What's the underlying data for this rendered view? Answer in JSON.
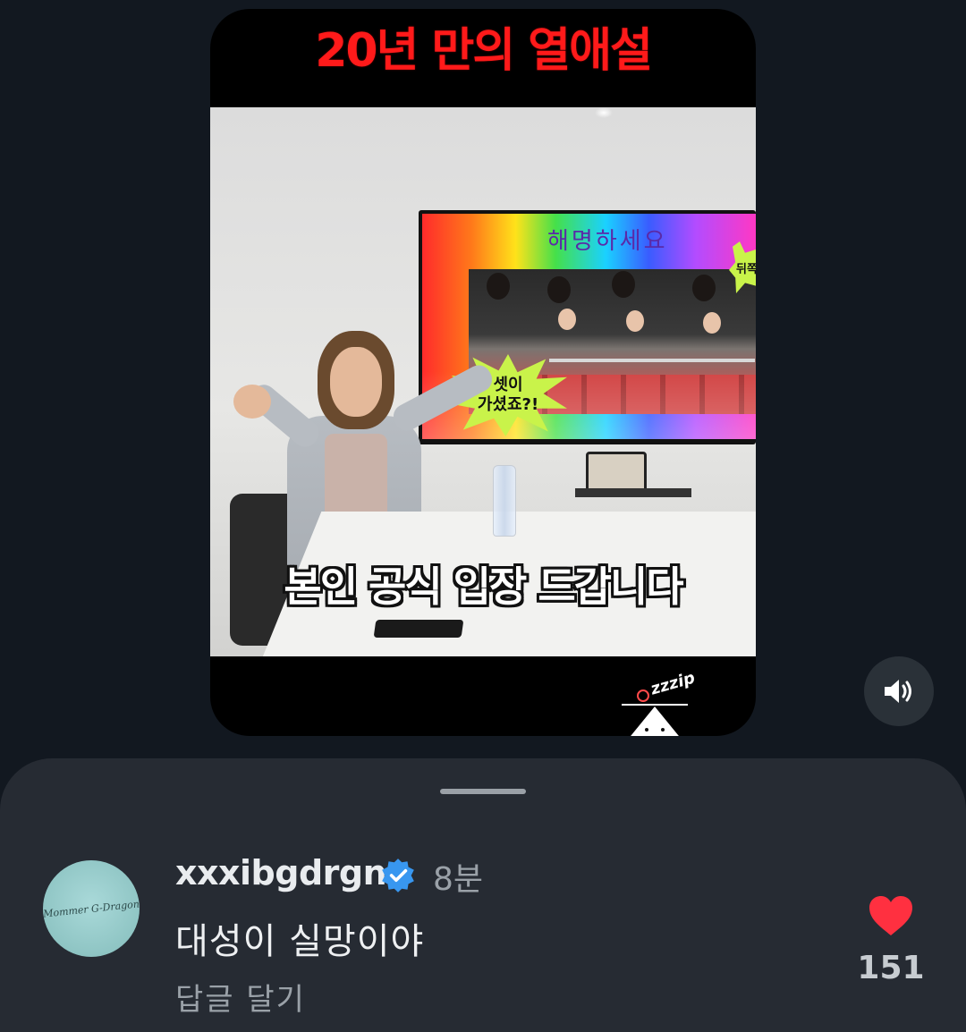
{
  "video": {
    "title": "20년 만의 열애설",
    "tv_heading": "해명하세요",
    "burst_text_line1": "셋이",
    "burst_text_line2": "가셨죠?!",
    "burst_small_text": "뒤쪽",
    "subtitle": "본인 공식 입장 드갑니다",
    "mascot_text": "zzzip"
  },
  "controls": {
    "mute_icon": "speaker-volume-icon"
  },
  "comment": {
    "avatar_text": "Mommer G-Dragon",
    "username": "xxxibgdrgn",
    "verified": true,
    "time": "8분",
    "text": "대성이 실망이야",
    "reply_label": "답글 달기",
    "like_count": "151",
    "liked": true
  },
  "colors": {
    "background": "#121820",
    "sheet": "#262b33",
    "title_red": "#ff1a1a",
    "verified_blue": "#3897f0",
    "like_red": "#ff3040"
  }
}
